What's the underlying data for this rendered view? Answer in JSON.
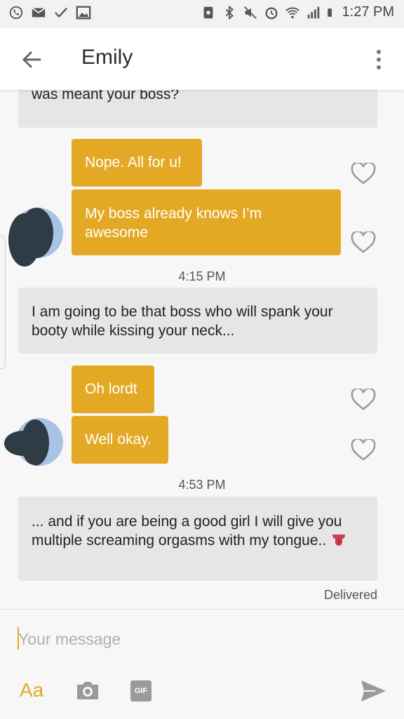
{
  "status_bar": {
    "time": "1:27 PM",
    "left_icons": [
      "whatsapp-icon",
      "mail-icon",
      "check-icon",
      "image-icon"
    ],
    "right_icons": [
      "recycle-icon",
      "bluetooth-icon",
      "mute-icon",
      "alarm-icon",
      "wifi-icon",
      "signal-icon",
      "battery-icon"
    ]
  },
  "header": {
    "title": "Emily"
  },
  "messages": {
    "m1": "Did you accidentally send me this message that was meant your boss?",
    "m2": "Nope. All for u!",
    "m3": "My boss already knows I’m awesome",
    "ts1": "4:15 PM",
    "m4": "I am going to be that boss who will spank your booty while kissing your neck...",
    "m5": "Oh lordt",
    "m6": "Well okay.",
    "ts2": "4:53 PM",
    "m7": "... and if you are being a good girl I will give you multiple screaming orgasms with my tongue..",
    "m7_emoji": "tongue-emoji",
    "delivered": "Delivered"
  },
  "composer": {
    "placeholder": "Your message",
    "aa_label": "Aa",
    "gif_label": "GIF"
  },
  "colors": {
    "accent": "#e3a925",
    "incoming_bubble": "#e6e6e6",
    "background": "#f7f7f7"
  }
}
